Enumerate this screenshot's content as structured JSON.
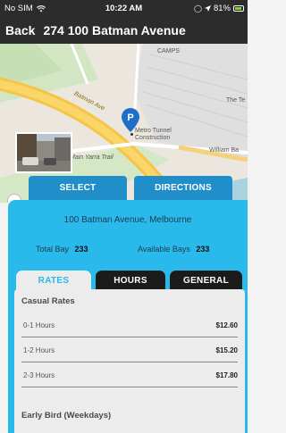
{
  "status_bar": {
    "carrier": "No SIM",
    "time": "10:22 AM",
    "battery": "81%"
  },
  "header": {
    "back_label": "Back",
    "title": "274 100 Batman Avenue"
  },
  "map": {
    "labels": {
      "camps": "CAMPS",
      "street": "Batman Ave",
      "poi": "Metro Tunnel Construction",
      "trail": "Main Yarra Trail",
      "william": "William Ba",
      "the_te": "The Te"
    }
  },
  "actions": {
    "select_label": "SELECT",
    "directions_label": "DIRECTIONS"
  },
  "location": {
    "address": "100 Batman Avenue, Melbourne",
    "total_bay_label": "Total Bay",
    "total_bay_value": "233",
    "available_bays_label": "Available Bays",
    "available_bays_value": "233"
  },
  "tabs": {
    "rates": "RATES",
    "hours": "HOURS",
    "general": "GENERAL"
  },
  "rates": {
    "casual_title": "Casual Rates",
    "rows": [
      {
        "label": "0-1 Hours",
        "value": "$12.60"
      },
      {
        "label": "1-2 Hours",
        "value": "$15.20"
      },
      {
        "label": "2-3 Hours",
        "value": "$17.80"
      }
    ],
    "early_bird_title": "Early Bird (Weekdays)"
  },
  "colors": {
    "accent": "#29b9ea",
    "button": "#1f8ec9",
    "header": "#2c2c2c"
  }
}
